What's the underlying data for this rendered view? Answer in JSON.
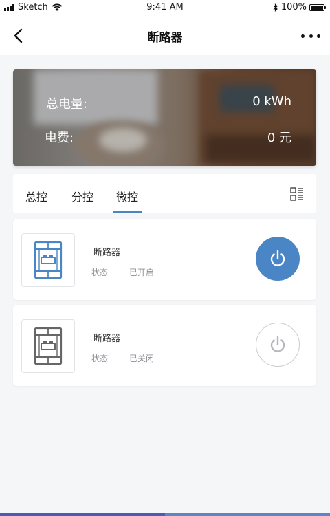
{
  "status_bar": {
    "carrier": "Sketch",
    "time": "9:41 AM",
    "battery": "100%"
  },
  "nav": {
    "title": "断路器"
  },
  "summary": {
    "energy_label": "总电量:",
    "energy_value": "0 kWh",
    "fee_label": "电费:",
    "fee_value": "0 元"
  },
  "tabs": [
    {
      "label": "总控",
      "active": false
    },
    {
      "label": "分控",
      "active": false
    },
    {
      "label": "微控",
      "active": true
    }
  ],
  "devices": [
    {
      "name": "断路器",
      "status_label": "状态",
      "status_value": "已开启",
      "power_on": true,
      "icon_color": "#4a86c5"
    },
    {
      "name": "断路器",
      "status_label": "状态",
      "status_value": "已关闭",
      "power_on": false,
      "icon_color": "#666666"
    }
  ],
  "colors": {
    "accent": "#4a86c5",
    "background": "#f5f6f8"
  },
  "icons": [
    "back-arrow-icon",
    "more-dots-icon",
    "list-grid-icon",
    "breaker-icon",
    "power-icon"
  ]
}
